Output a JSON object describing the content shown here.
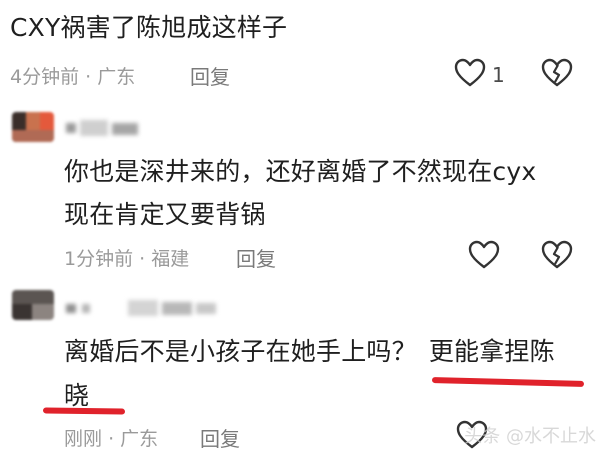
{
  "comments": [
    {
      "text": "CXY祸害了陈旭成这样子",
      "time": "4分钟前",
      "location": "广东",
      "reply_label": "回复",
      "like_count": "1"
    },
    {
      "text_line1": "你也是深井来的，还好离婚了不然现在cyx",
      "text_line2": "现在肯定又要背锅",
      "time": "1分钟前",
      "location": "福建",
      "reply_label": "回复"
    },
    {
      "text_part1": "离婚后不是小孩子在她手上吗？",
      "text_part2": "更能拿捏陈",
      "text_line2": "晓",
      "time": "刚刚",
      "location": "广东",
      "reply_label": "回复"
    }
  ],
  "separator": "·",
  "colors": {
    "text": "#1f1f1f",
    "meta": "#9a9a9a",
    "underline": "#e0222b"
  },
  "icons": [
    "heart-icon",
    "broken-heart-icon"
  ],
  "watermark": "头条 @水不止水"
}
